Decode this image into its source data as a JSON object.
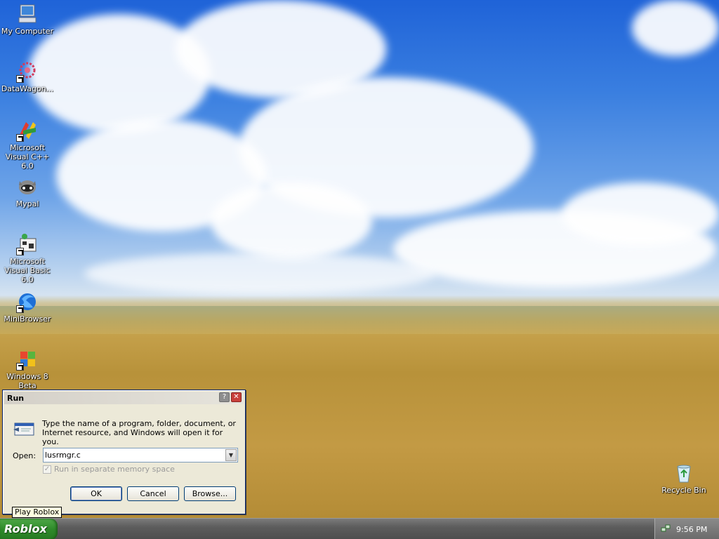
{
  "desktop": {
    "icons": [
      {
        "label": "My Computer",
        "icon": "my-computer-icon"
      },
      {
        "label": "DataWagon...",
        "icon": "datawagon-icon"
      },
      {
        "label": "Microsoft Visual C++ 6.0",
        "icon": "visual-cpp-icon"
      },
      {
        "label": "Mypal",
        "icon": "mypal-icon"
      },
      {
        "label": "Microsoft Visual Basic 6.0",
        "icon": "visual-basic-icon"
      },
      {
        "label": "MiniBrowser",
        "icon": "minibrowser-icon"
      },
      {
        "label": "Windows 8 Beta",
        "icon": "windows-logo-icon"
      },
      {
        "label": "Recycle Bin",
        "icon": "recycle-bin-icon"
      }
    ]
  },
  "run_dialog": {
    "title": "Run",
    "description": "Type the name of a program, folder, document, or Internet resource, and Windows will open it for you.",
    "open_label": "Open:",
    "open_value": "lusrmgr.c",
    "checkbox_label": "Run in separate memory space",
    "ok_label": "OK",
    "cancel_label": "Cancel",
    "browse_label": "Browse...",
    "help_glyph": "?",
    "close_glyph": "✕"
  },
  "tooltip": "Play Roblox",
  "taskbar": {
    "start_label": "Roblox",
    "clock": "9:56 PM"
  }
}
